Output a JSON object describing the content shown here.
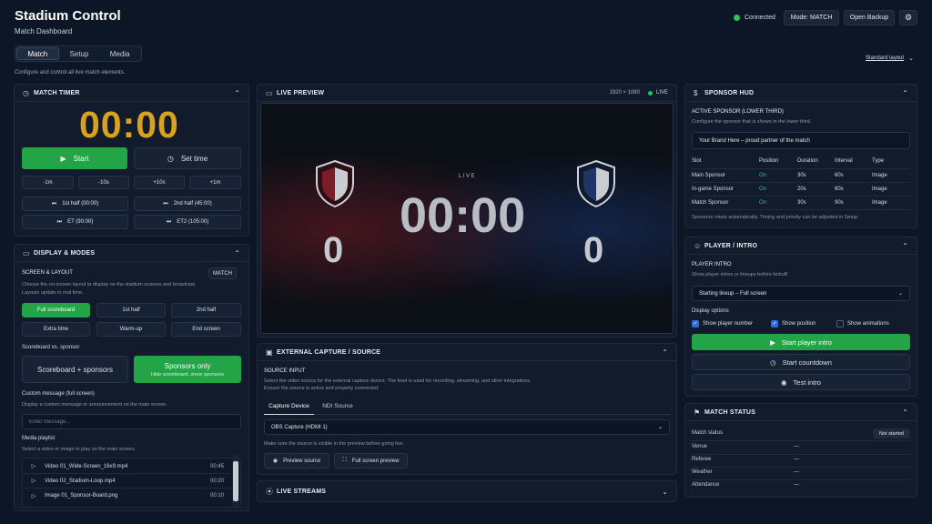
{
  "app": {
    "title": "Stadium Control",
    "subtitle": "Match Dashboard"
  },
  "header": {
    "connection": "Connected",
    "mode_button": "Mode: MATCH",
    "backup_button": "Open Backup",
    "settings_icon": "gear-icon"
  },
  "tabs": [
    {
      "label": "Match"
    },
    {
      "label": "Setup"
    },
    {
      "label": "Media"
    }
  ],
  "page_hint": "Configure and control all live match elements.",
  "layout_link": "Standard layout",
  "match_timer": {
    "title": "MATCH TIMER",
    "time": "00:00",
    "start_label": "Start",
    "set_time_label": "Set time",
    "adjust": [
      "-1m",
      "-10s",
      "+10s",
      "+1m"
    ],
    "periods": [
      "1st half (00:00)",
      "2nd half (45:00)",
      "ET (90:00)",
      "ET2 (105:00)"
    ]
  },
  "display": {
    "title": "DISPLAY & MODES",
    "screen_layout_title": "SCREEN & LAYOUT",
    "match_badge": "MATCH",
    "desc1": "Choose the on-screen layout to display on the stadium screens and broadcast.",
    "desc2": "Layouts update in real time.",
    "layouts": [
      "Full scoreboard",
      "1st half",
      "2nd half",
      "Extra time",
      "Warm-up",
      "End screen"
    ],
    "sb_vs_sponsor": "Scoreboard vs. sponsor",
    "sb_sponsors": "Scoreboard + sponsors",
    "sponsors_only": "Sponsors only",
    "sponsors_only_sub": "Hide scoreboard, show sponsors",
    "custom_msg_title": "Custom message (full screen)",
    "custom_msg_desc": "Display a custom message or announcement on the main screen.",
    "custom_msg_placeholder": "Enter message...",
    "playlist_title": "Media playlist",
    "playlist_desc": "Select a video or image to play on the main screen.",
    "playlist": [
      {
        "name": "Video 01_Wide-Screen_16x9.mp4",
        "duration": "00:45"
      },
      {
        "name": "Video 02_Stadium-Loop.mp4",
        "duration": "00:20"
      },
      {
        "name": "Image 01_Sponsor-Board.png",
        "duration": "00:10"
      }
    ]
  },
  "preview": {
    "title": "LIVE PREVIEW",
    "resolution": "1920 × 1080",
    "live": "LIVE",
    "stage_live": "LIVE",
    "stage_time": "00:00",
    "score_home": "0",
    "score_away": "0"
  },
  "capture": {
    "title": "EXTERNAL CAPTURE / SOURCE",
    "input_title": "SOURCE INPUT",
    "desc1": "Select the video source for the external capture device. The feed is used for recording, streaming, and other integrations.",
    "desc2": "Ensure the source is active and properly connected.",
    "tabs": [
      "Capture Device",
      "NDI Source"
    ],
    "selected": "OBS Capture (HDMI 1)",
    "hint": "Make sure the source is visible in the preview before going live.",
    "preview_btn": "Preview source",
    "fullscreen_btn": "Full screen preview"
  },
  "streams": {
    "title": "LIVE STREAMS"
  },
  "sponsor_hud": {
    "title": "SPONSOR HUD",
    "active_title": "ACTIVE SPONSOR (LOWER THIRD)",
    "active_desc": "Configure the sponsor that is shown in the lower third.",
    "active_value": "Your Brand Here – proud partner of the match",
    "columns": [
      "Slot",
      "Position",
      "Duration",
      "Interval",
      "Type"
    ],
    "rows": [
      [
        "Main Sponsor",
        "On",
        "30s",
        "60s",
        "Image"
      ],
      [
        "In-game Sponsor",
        "On",
        "20s",
        "60s",
        "Image"
      ],
      [
        "Match Sponsor",
        "On",
        "30s",
        "90s",
        "Image"
      ]
    ],
    "footer": "Sponsors rotate automatically. Timing and priority can be adjusted in Setup."
  },
  "player_intro": {
    "title": "PLAYER / INTRO",
    "section": "PLAYER INTRO",
    "desc": "Show player intros or lineups before kickoff.",
    "selected": "Starting lineup – Full screen",
    "display_options": "Display options",
    "options": [
      {
        "label": "Show player number",
        "checked": true
      },
      {
        "label": "Show position",
        "checked": true
      },
      {
        "label": "Show animations",
        "checked": false
      }
    ],
    "start_intro": "Start player intro",
    "start_countdown": "Start countdown",
    "test_intro": "Test intro"
  },
  "match_status": {
    "title": "MATCH STATUS",
    "rows": [
      {
        "label": "Match status",
        "value": "Not started"
      },
      {
        "label": "Venue",
        "value": "—"
      },
      {
        "label": "Referee",
        "value": "—"
      },
      {
        "label": "Weather",
        "value": "—"
      },
      {
        "label": "Attendance",
        "value": "—"
      }
    ]
  },
  "colors": {
    "accent_green": "#22a447",
    "timer_amber": "#d9a21b",
    "bg": "#0d1626"
  }
}
